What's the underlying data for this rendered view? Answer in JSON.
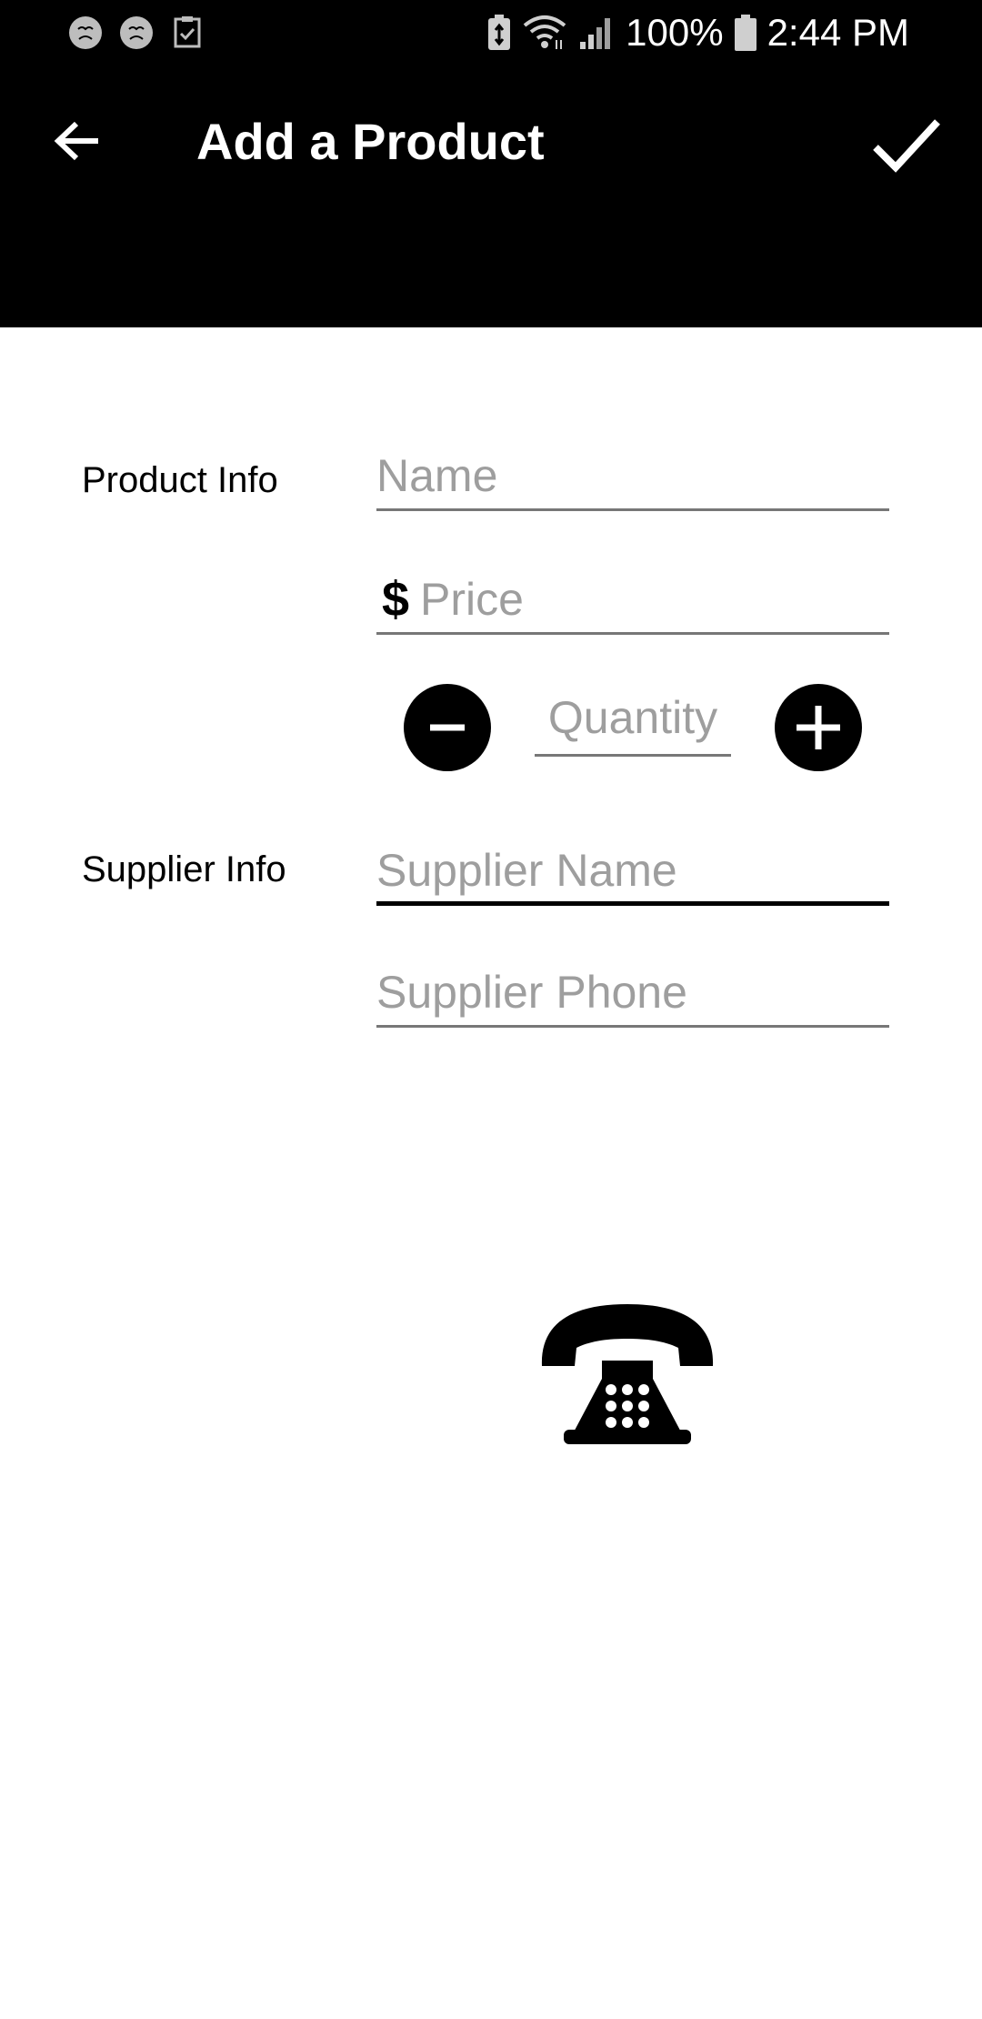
{
  "status_bar": {
    "battery_percent": "100%",
    "time": "2:44 PM",
    "icons": [
      "face-notification-icon",
      "face-notification-icon",
      "checklist-notification-icon",
      "battery-saver-icon",
      "wifi-icon",
      "signal-icon",
      "battery-icon"
    ]
  },
  "toolbar": {
    "title": "Add a Product",
    "back_icon": "arrow-back-icon",
    "done_icon": "checkmark-icon"
  },
  "product_info": {
    "label": "Product Info",
    "name_placeholder": "Name",
    "currency_symbol": "$",
    "price_placeholder": "Price",
    "quantity_placeholder": "Quantity",
    "decrement_icon": "minus-circle-icon",
    "increment_icon": "plus-circle-icon"
  },
  "supplier_info": {
    "label": "Supplier Info",
    "name_placeholder": "Supplier Name",
    "phone_placeholder": "Supplier Phone",
    "call_icon": "telephone-icon"
  },
  "colors": {
    "app_bar": "#000000",
    "background": "#ffffff",
    "hint_text": "#9e9e9e",
    "underline": "#777777"
  }
}
